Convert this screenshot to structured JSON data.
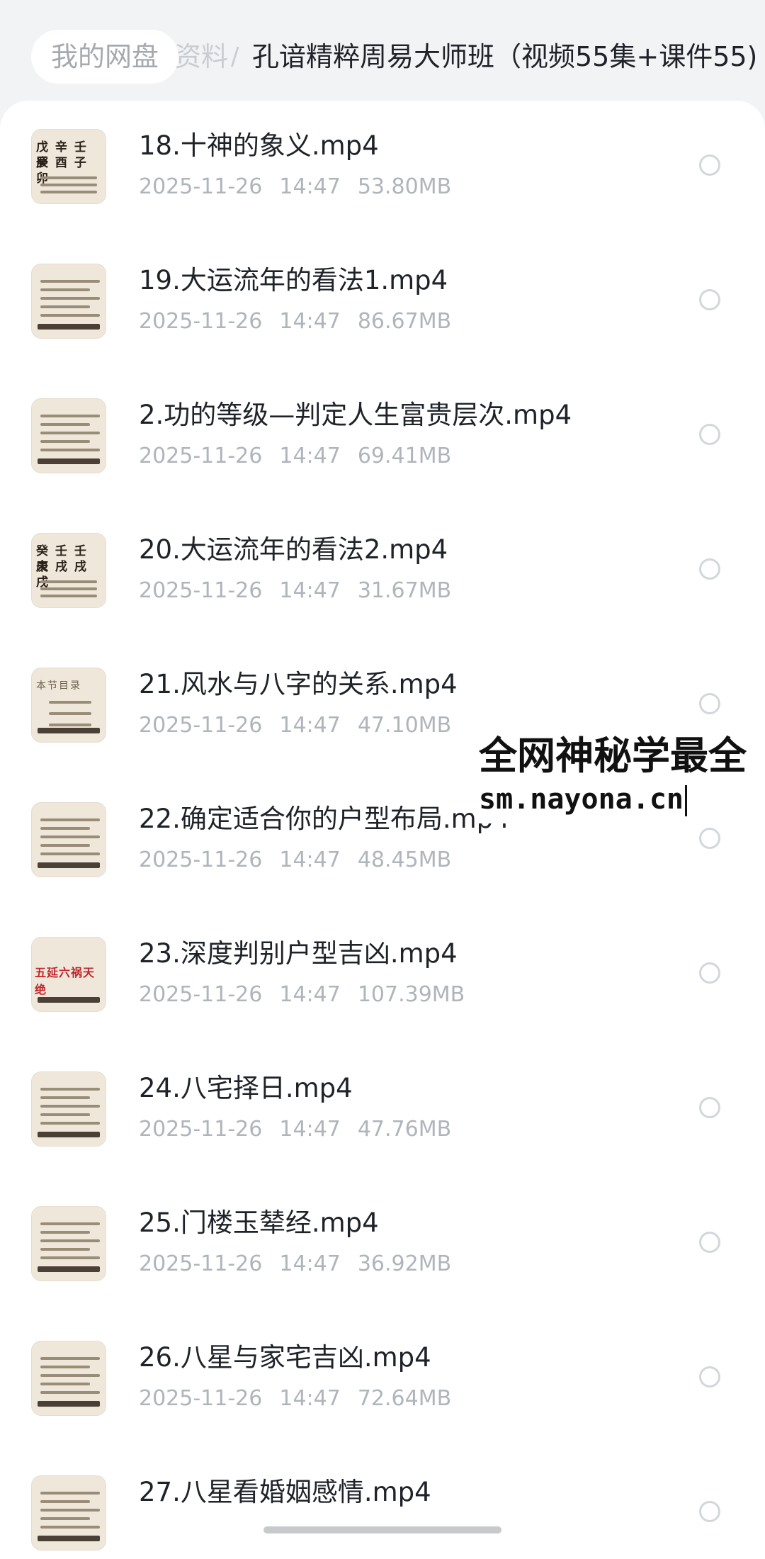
{
  "breadcrumb": {
    "root": "我的网盘",
    "middle": "资料",
    "separator": "/",
    "current": "孔谙精粹周易大师班（视频55集+课件55)"
  },
  "files": [
    {
      "name": "18.十神的象义.mp4",
      "date": "2025-11-26",
      "time": "14:47",
      "size": "53.80MB",
      "thumb": "table"
    },
    {
      "name": "19.大运流年的看法1.mp4",
      "date": "2025-11-26",
      "time": "14:47",
      "size": "86.67MB",
      "thumb": "text"
    },
    {
      "name": "2.功的等级—判定人生富贵层次.mp4",
      "date": "2025-11-26",
      "time": "14:47",
      "size": "69.41MB",
      "thumb": "text"
    },
    {
      "name": "20.大运流年的看法2.mp4",
      "date": "2025-11-26",
      "time": "14:47",
      "size": "31.67MB",
      "thumb": "table"
    },
    {
      "name": "21.风水与八字的关系.mp4",
      "date": "2025-11-26",
      "time": "14:47",
      "size": "47.10MB",
      "thumb": "toc"
    },
    {
      "name": "22.确定适合你的户型布局.mp4",
      "date": "2025-11-26",
      "time": "14:47",
      "size": "48.45MB",
      "thumb": "hand"
    },
    {
      "name": "23.深度判别户型吉凶.mp4",
      "date": "2025-11-26",
      "time": "14:47",
      "size": "107.39MB",
      "thumb": "red"
    },
    {
      "name": "24.八宅择日.mp4",
      "date": "2025-11-26",
      "time": "14:47",
      "size": "47.76MB",
      "thumb": "text"
    },
    {
      "name": "25.门楼玉辇经.mp4",
      "date": "2025-11-26",
      "time": "14:47",
      "size": "36.92MB",
      "thumb": "text"
    },
    {
      "name": "26.八星与家宅吉凶.mp4",
      "date": "2025-11-26",
      "time": "14:47",
      "size": "72.64MB",
      "thumb": "text"
    },
    {
      "name": "27.八星看婚姻感情.mp4",
      "date": "",
      "time": "",
      "size": "",
      "thumb": "text"
    }
  ],
  "thumb_text": {
    "table_top": "戊 辛 壬 癸",
    "table_bottom": "辰 酉 子 卯",
    "table2_top": "癸 壬 壬 庚",
    "table2_bottom": "未 戌 戌 戌",
    "toc": "本节目录",
    "red": "五延六祸天绝"
  },
  "watermark": {
    "line1": "全网神秘学最全",
    "line2": "sm.nayona.cn"
  },
  "colors": {
    "page_bg": "#f2f3f5",
    "panel_bg": "#ffffff",
    "primary_text": "#1f2329",
    "meta_text": "#b0b4bb",
    "thumb_bg": "#efe7da"
  }
}
